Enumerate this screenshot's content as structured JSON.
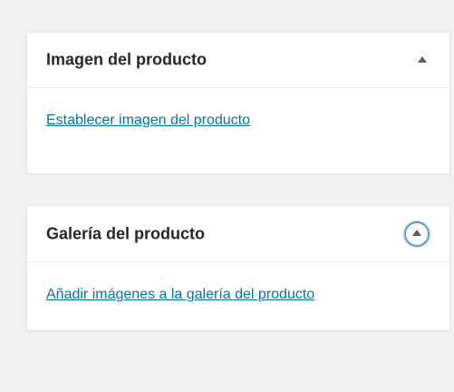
{
  "panels": {
    "product_image": {
      "title": "Imagen del producto",
      "link": "Establecer imagen del producto",
      "toggle_icon": "triangle-up"
    },
    "product_gallery": {
      "title": "Galería del producto",
      "link": "Añadir imágenes a la galería del producto",
      "toggle_icon": "triangle-up"
    }
  },
  "colors": {
    "background": "#f1f1f1",
    "panel": "#ffffff",
    "link": "#0073aa",
    "focus_ring": "#5b9dd9"
  }
}
